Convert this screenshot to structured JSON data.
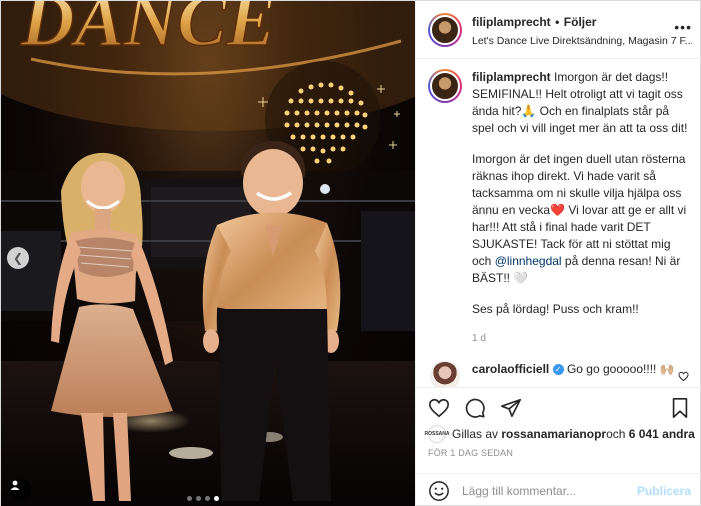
{
  "post": {
    "photo_label": "DANCE",
    "carousel_prev_icon": "chevron-left-icon",
    "carousel_dots": [
      false,
      false,
      false,
      true
    ]
  },
  "header": {
    "username": "filiplamprecht",
    "separator": "•",
    "follow_label": "Följer",
    "location": "Let's Dance Live Direktsändning, Magasin 7 F...",
    "more_icon": "•••"
  },
  "caption": {
    "username": "filiplamprecht",
    "para1": "Imorgon är det dags!! SEMIFINAL!! Helt otroligt att vi tagit oss ända hit?🙏  Och en finalplats står på spel och vi vill inget mer än att ta oss dit!",
    "para2a": "Imorgon är det ingen duell utan rösterna räknas ihop direkt. Vi hade varit så tacksamma om ni skulle vilja hjälpa oss ännu en vecka❤️  Vi lovar att ge er allt vi har!!! Att stå i final hade varit DET SJUKASTE! Tack för att ni stöttat mig och ",
    "mention": "@linnhegdal",
    "para2b": " på denna resan! Ni är BÄST!! 🤍",
    "para3": "Ses på lördag! Puss och kram!!",
    "time": "1 d"
  },
  "comment": {
    "username": "carolaofficiell",
    "text": "Go go gooooo!!!! 🙌🏼"
  },
  "likes": {
    "prefix": "Gillas av ",
    "user": "rossanamarianopr",
    "mid": " och ",
    "count": "6 041 andra",
    "avatar_text": "ROSSANA"
  },
  "date": "FÖR 1 DAG SEDAN",
  "add_comment": {
    "placeholder": "Lägg till kommentar...",
    "publish_label": "Publicera"
  }
}
